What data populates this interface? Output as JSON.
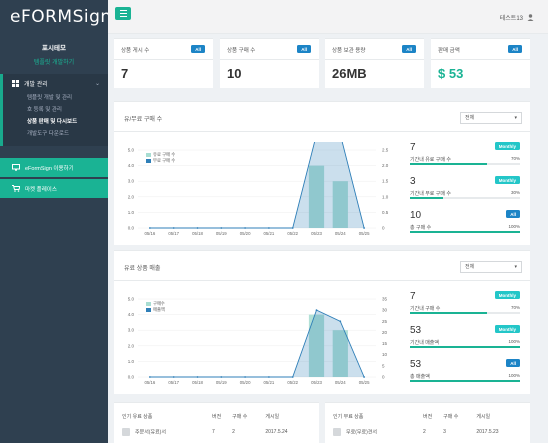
{
  "sidebar": {
    "logo": "eFORMSign",
    "profile_name": "포시테모",
    "profile_link": "템플릿 개발하기",
    "section_label": "개발 관리",
    "sub_items": [
      {
        "label": "템플릿 개발 및 관리"
      },
      {
        "label": "호 등록 및 관리"
      },
      {
        "label": "상품 판매 및 다시보드"
      },
      {
        "label": "개발도구 다운로드"
      }
    ],
    "item_use": "eFormSign 이용하기",
    "item_market": "마켓 플레이스"
  },
  "topbar": {
    "user": "테스트13"
  },
  "stats": [
    {
      "title": "상품 게시 수",
      "badge": "All",
      "value": "7"
    },
    {
      "title": "상품 구매 수",
      "badge": "All",
      "value": "10"
    },
    {
      "title": "상품 보관 용량",
      "badge": "All",
      "value": "26MB"
    },
    {
      "title": "판매 금액",
      "badge": "All",
      "value": "$ 53"
    }
  ],
  "panel1": {
    "title": "유/무료 구매 수",
    "select": "전체",
    "metrics": [
      {
        "value": "7",
        "label": "기간내 유료 구매 수",
        "badge": "Monthly",
        "pct": "70%"
      },
      {
        "value": "3",
        "label": "기간내 무료 구매 수",
        "badge": "Monthly",
        "pct": "30%"
      },
      {
        "value": "10",
        "label": "총 구매 수",
        "badge": "All",
        "pct": "100%"
      }
    ]
  },
  "panel2": {
    "title": "유료 상품 매출",
    "select": "전체",
    "metrics": [
      {
        "value": "7",
        "label": "기간내 구매 수",
        "badge": "Monthly",
        "pct": "70%"
      },
      {
        "value": "53",
        "label": "기간내 매출액",
        "badge": "Monthly",
        "pct": "100%"
      },
      {
        "value": "53",
        "label": "총 매출액",
        "badge": "All",
        "pct": "100%"
      }
    ]
  },
  "table1": {
    "title": "인기 유료 상품",
    "headers": [
      "버전",
      "구매 수",
      "게시일"
    ],
    "row": {
      "name": "주문서(유료)서",
      "version": "7",
      "count": "2",
      "date": "2017.5.24"
    }
  },
  "table2": {
    "title": "인기 무료 상품",
    "headers": [
      "버전",
      "구매 수",
      "게시일"
    ],
    "row": {
      "name": "무료(무료)견서",
      "version": "2",
      "count": "3",
      "date": "2017.5.23"
    }
  },
  "chart_data": [
    {
      "type": "bar",
      "categories": [
        "05/16",
        "05/17",
        "05/18",
        "05/19",
        "05/20",
        "05/21",
        "05/22",
        "05/23",
        "05/24",
        "05/25"
      ],
      "series": [
        {
          "name": "유료 구매 수",
          "values": [
            0,
            0,
            0,
            0,
            0,
            0,
            0,
            4,
            3,
            0
          ],
          "axis": "left",
          "color": "#a8ddd2"
        },
        {
          "name": "무료 구매 수",
          "values": [
            0,
            0,
            0,
            0,
            0,
            0,
            0,
            3,
            3,
            0
          ],
          "axis": "right",
          "color": "#2f7fb8"
        }
      ],
      "ylim_left": [
        0,
        5
      ],
      "ylim_right": [
        0,
        2.5
      ],
      "left_ticks": [
        "5.0",
        "4.0",
        "3.0",
        "2.0",
        "1.0",
        "0.0"
      ],
      "right_ticks": [
        "2.5",
        "2.0",
        "1.5",
        "1.0",
        "0.5",
        "0"
      ]
    },
    {
      "type": "bar",
      "categories": [
        "05/16",
        "05/17",
        "05/18",
        "05/19",
        "05/20",
        "05/21",
        "05/22",
        "05/23",
        "05/24",
        "05/25"
      ],
      "series": [
        {
          "name": "구매수",
          "values": [
            0,
            0,
            0,
            0,
            0,
            0,
            0,
            4,
            3,
            0
          ],
          "axis": "left",
          "color": "#a8ddd2"
        },
        {
          "name": "매출액",
          "values": [
            0,
            0,
            0,
            0,
            0,
            0,
            0,
            30,
            25,
            0
          ],
          "axis": "right",
          "color": "#2f7fb8"
        }
      ],
      "ylim_left": [
        0,
        5
      ],
      "ylim_right": [
        0,
        35
      ],
      "left_ticks": [
        "5.0",
        "4.0",
        "3.0",
        "2.0",
        "1.0",
        "0.0"
      ],
      "right_ticks": [
        "35",
        "30",
        "25",
        "20",
        "15",
        "10",
        "5",
        "0"
      ]
    }
  ]
}
